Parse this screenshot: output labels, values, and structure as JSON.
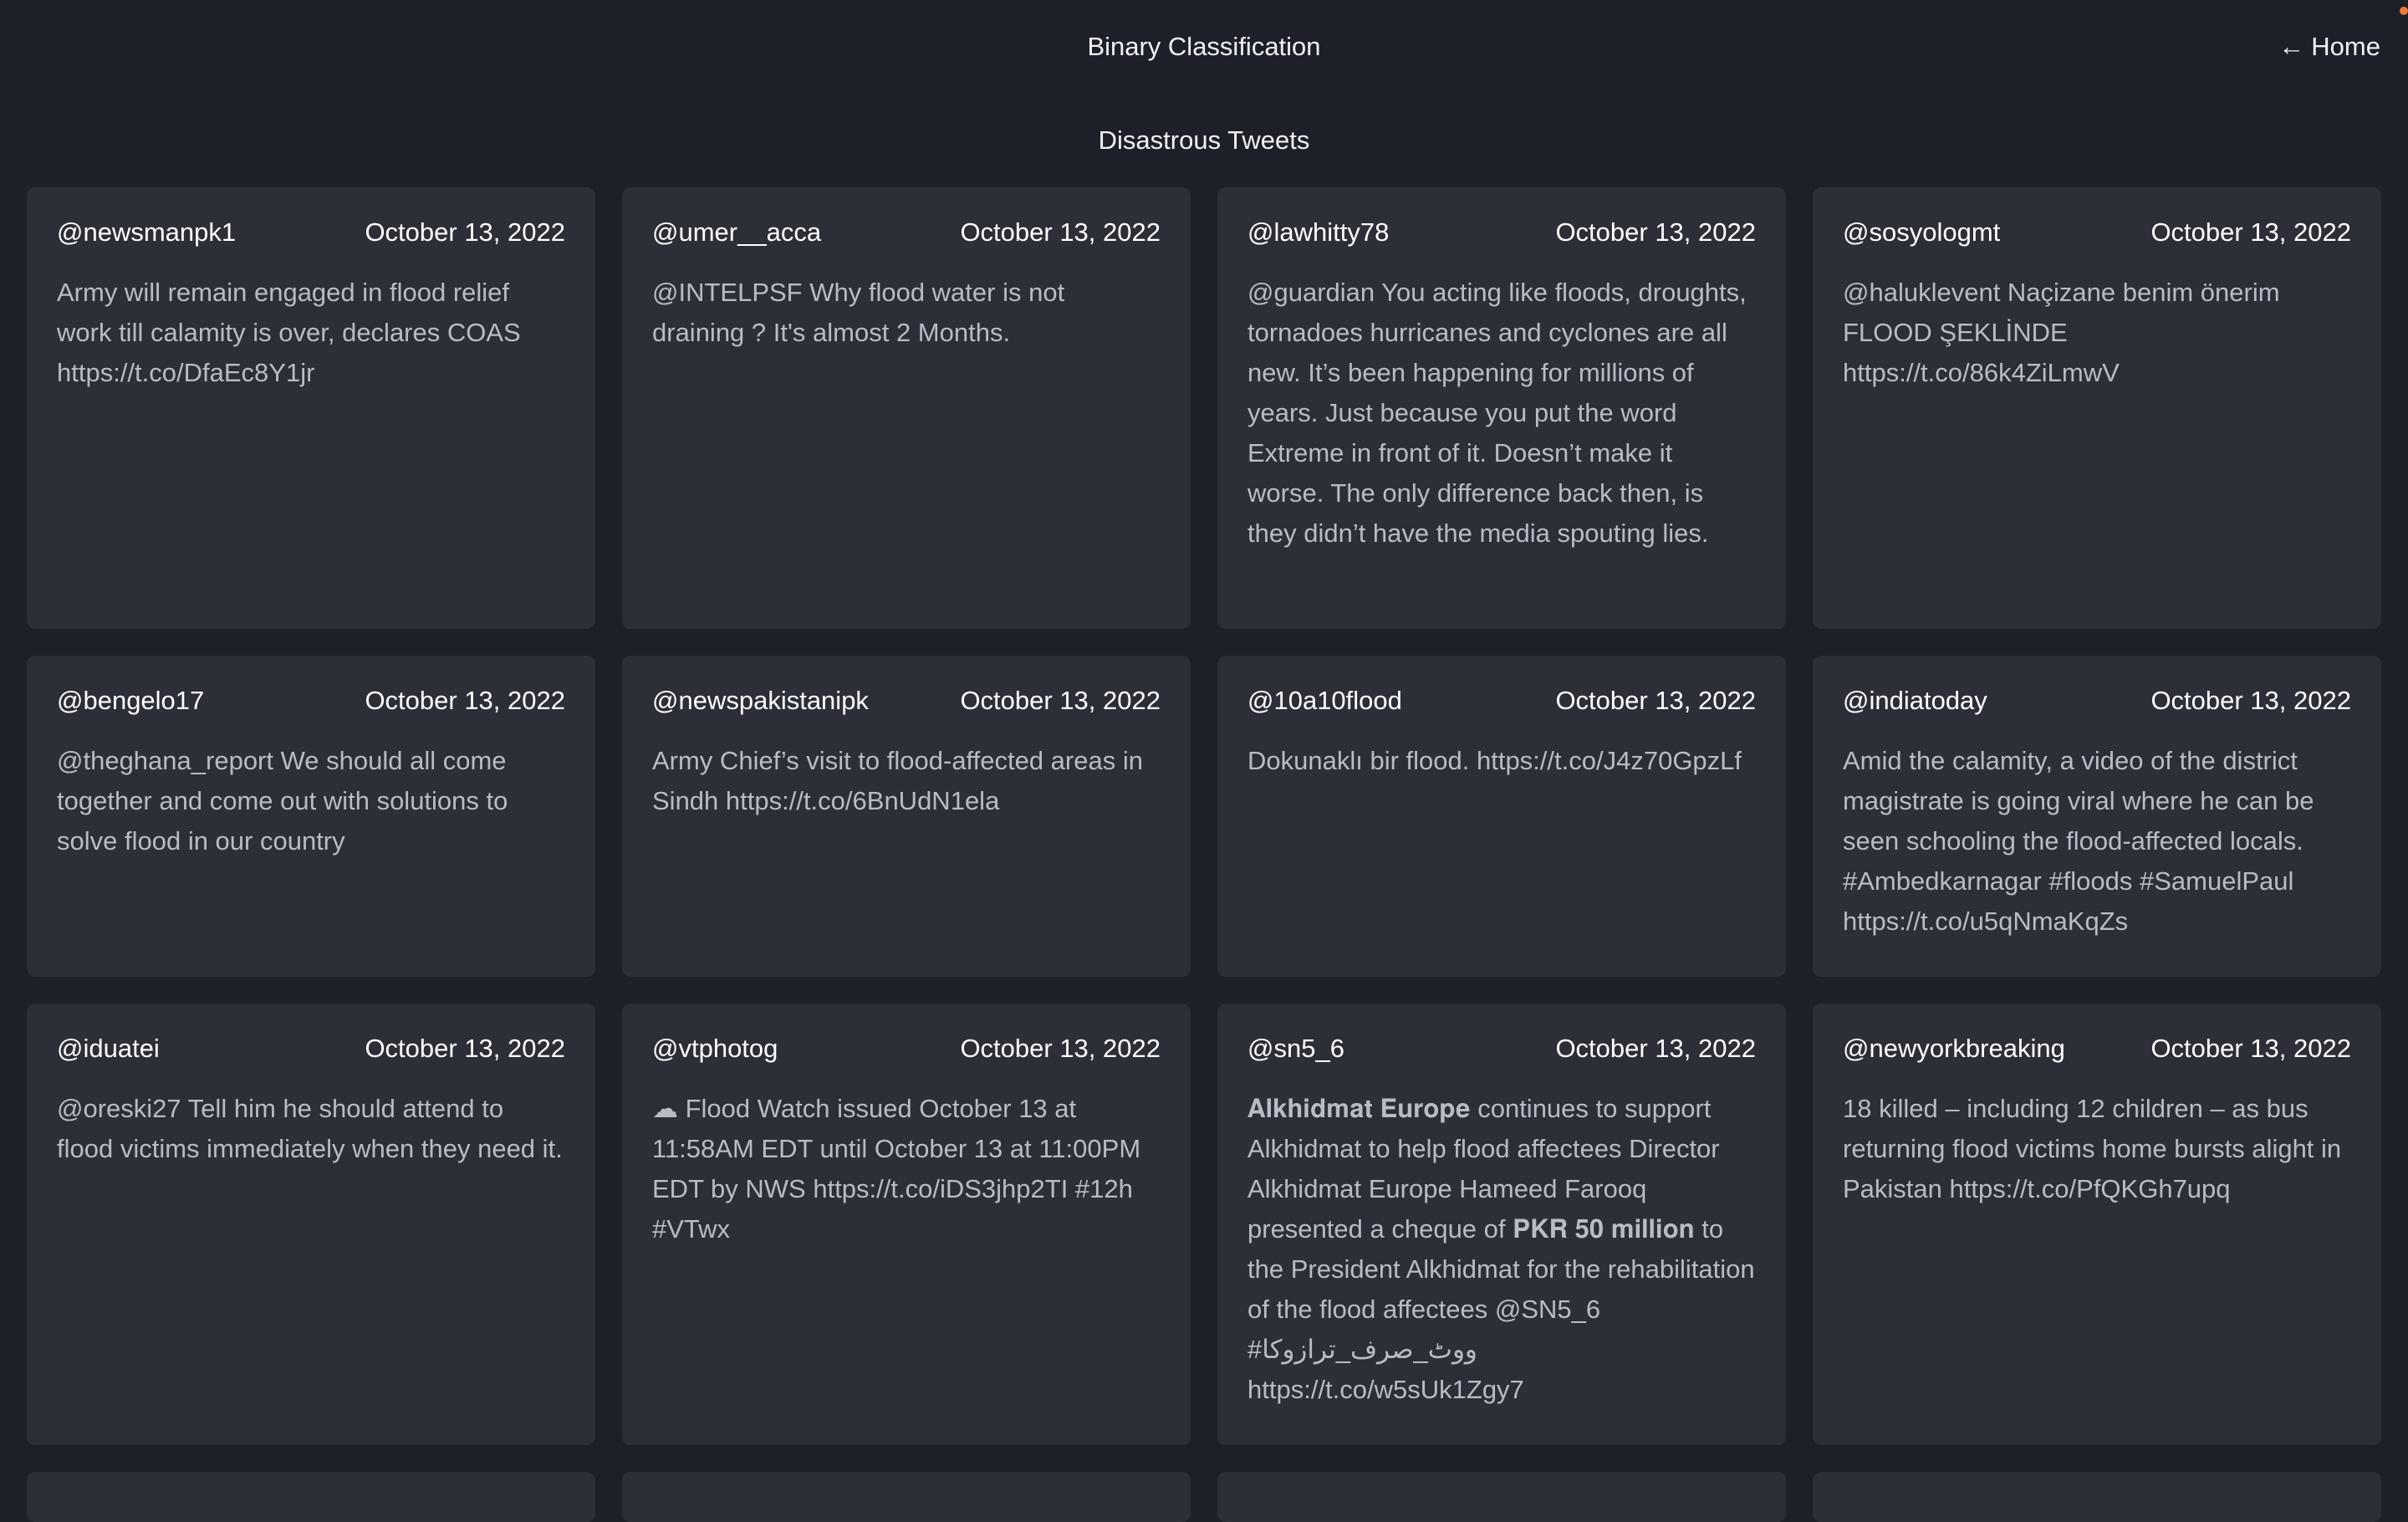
{
  "header": {
    "title": "Binary Classification",
    "home_label": "Home",
    "home_arrow": "←"
  },
  "section": {
    "title": "Disastrous Tweets"
  },
  "tweets": [
    {
      "user": "@newsmanpk1",
      "date": "October 13, 2022",
      "text": "Army will remain engaged in flood relief work till calamity is over, declares COAS https://t.co/DfaEc8Y1jr"
    },
    {
      "user": "@umer__acca",
      "date": "October 13, 2022",
      "text": "@INTELPSF Why flood water is not draining ? It's almost 2 Months."
    },
    {
      "user": "@lawhitty78",
      "date": "October 13, 2022",
      "text": "@guardian You acting like floods, droughts, tornadoes hurricanes and cyclones are all new. It’s been happening for millions of years. Just because you put the word Extreme in front of it. Doesn’t make it worse. The only difference back then, is they didn’t have the media spouting lies."
    },
    {
      "user": "@sosyologmt",
      "date": "October 13, 2022",
      "text": "@haluklevent Naçizane benim önerim FLOOD ŞEKLİNDE https://t.co/86k4ZiLmwV"
    },
    {
      "user": "@bengelo17",
      "date": "October 13, 2022",
      "text": "@theghana_report We should all come together and come out with solutions to solve flood in our country"
    },
    {
      "user": "@newspakistanipk",
      "date": "October 13, 2022",
      "text": "Army Chief’s visit to flood-affected areas in Sindh https://t.co/6BnUdN1ela"
    },
    {
      "user": "@10a10flood",
      "date": "October 13, 2022",
      "text": "Dokunaklı bir flood. https://t.co/J4z70GpzLf"
    },
    {
      "user": "@indiatoday",
      "date": "October 13, 2022",
      "text": "Amid the calamity, a video of the district magistrate is going viral where he can be seen schooling the flood-affected locals. #Ambedkarnagar #floods #SamuelPaul https://t.co/u5qNmaKqZs"
    },
    {
      "user": "@iduatei",
      "date": "October 13, 2022",
      "text": "@oreski27 Tell him he should attend to flood victims immediately when they need it."
    },
    {
      "user": "@vtphotog",
      "date": "October 13, 2022",
      "text": "☁ Flood Watch issued October 13 at 11:58AM EDT until October 13 at 11:00PM EDT by NWS https://t.co/iDS3jhp2TI #12h #VTwx"
    },
    {
      "user": "@sn5_6",
      "date": "October 13, 2022",
      "text": "𝐀𝐥𝐤𝐡𝐢𝐝𝐦𝐚𝐭 𝐄𝐮𝐫𝐨𝐩𝐞 continues to support Alkhidmat to help flood affectees Director Alkhidmat Europe Hameed Farooq presented a cheque of 𝐏𝐊𝐑 𝟓𝟎 𝐦𝐢𝐥𝐥𝐢𝐨𝐧 to the President Alkhidmat for the rehabilitation of the flood affectees @SN5_6 #ووٹ_صرف_ترازوکا https://t.co/w5sUk1Zgy7"
    },
    {
      "user": "@newyorkbreaking",
      "date": "October 13, 2022",
      "text": "18 killed – including 12 children – as bus returning flood victims home bursts alight in Pakistan https://t.co/PfQKGh7upq"
    }
  ]
}
